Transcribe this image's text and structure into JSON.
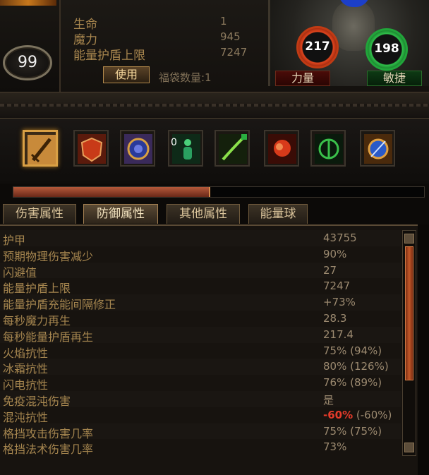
{
  "header": {
    "level": "99",
    "stats": [
      {
        "label": "生命",
        "value": "1"
      },
      {
        "label": "魔力",
        "value": "945"
      },
      {
        "label": "能量护盾上限",
        "value": "7247"
      }
    ],
    "use_button": "使用",
    "bag_count": "福袋数量:1"
  },
  "orbs": {
    "strength_value": "217",
    "strength_label": "力量",
    "dexterity_value": "198",
    "dexterity_label": "敏捷"
  },
  "skills": {
    "icons": [
      "sword-icon",
      "shield-icon",
      "rune-icon",
      "figure-icon",
      "vine-blade-icon",
      "fist-icon",
      "green-emblem-icon",
      "blue-orb-icon"
    ],
    "figure_count": "0"
  },
  "progress": {
    "fraction": 0.48
  },
  "tabs": [
    "伤害属性",
    "防御属性",
    "其他属性",
    "能量球"
  ],
  "active_tab": "防御属性",
  "attributes": [
    {
      "name": "护甲",
      "value": "43755"
    },
    {
      "name": "预期物理伤害减少",
      "value": "90%"
    },
    {
      "name": "闪避值",
      "value": "27"
    },
    {
      "name": "能量护盾上限",
      "value": "7247"
    },
    {
      "name": "能量护盾充能间隔修正",
      "value": "+73%"
    },
    {
      "name": "每秒魔力再生",
      "value": "28.3"
    },
    {
      "name": "每秒能量护盾再生",
      "value": "217.4"
    },
    {
      "name": "火焰抗性",
      "value": "75% (94%)"
    },
    {
      "name": "冰霜抗性",
      "value": "80% (126%)"
    },
    {
      "name": "闪电抗性",
      "value": "76% (89%)"
    },
    {
      "name": "免疫混沌伤害",
      "value": "是"
    },
    {
      "name": "混沌抗性",
      "value_neg": "-60%",
      "value_rest": " (-60%)"
    },
    {
      "name": "格挡攻击伤害几率",
      "value": "75% (75%)"
    },
    {
      "name": "格挡法术伤害几率",
      "value": "73%"
    }
  ],
  "colors": {
    "accent": "#d9a045",
    "negative": "#e43a2a",
    "label": "#a6864f"
  }
}
